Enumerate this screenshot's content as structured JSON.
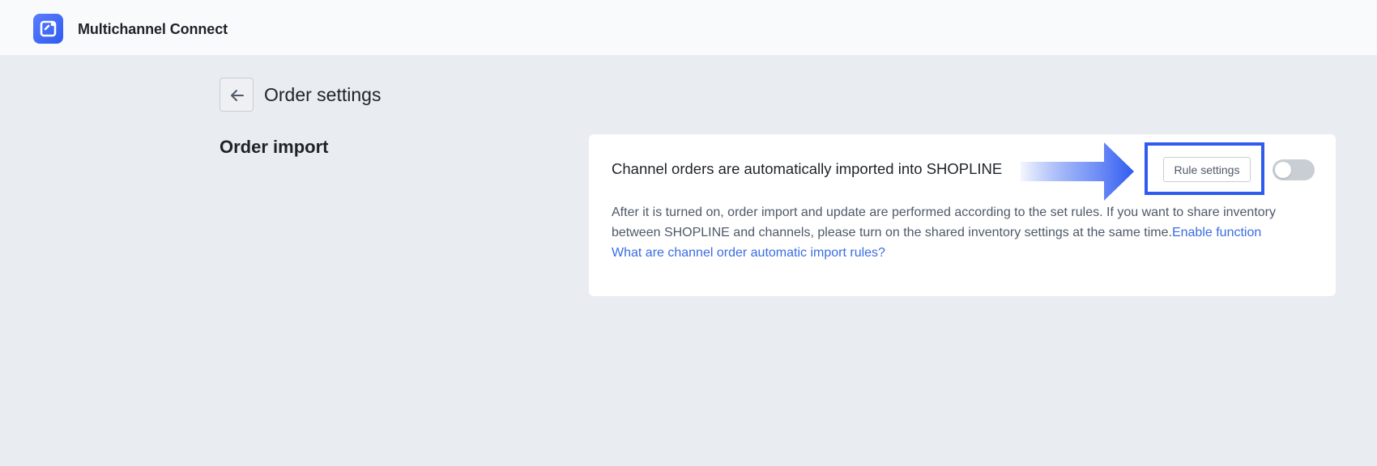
{
  "header": {
    "app_name": "Multichannel Connect",
    "logo_icon": "app-logo-icon"
  },
  "page": {
    "back_icon": "arrow-left-icon",
    "title": "Order settings"
  },
  "section": {
    "title": "Order import"
  },
  "card": {
    "headline": "Channel orders are automatically imported into SHOPLINE",
    "rule_button_label": "Rule settings",
    "toggle_on": false,
    "description": "After it is turned on, order import and update are performed according to the set rules. If you want to share inventory between SHOPLINE and channels, please turn on the shared inventory settings at the same time.",
    "enable_link": "Enable function",
    "rules_link": "What are channel order automatic import rules?"
  },
  "colors": {
    "accent": "#2f5bf0",
    "link": "#3a6ce3",
    "background": "#e9ecf1"
  }
}
